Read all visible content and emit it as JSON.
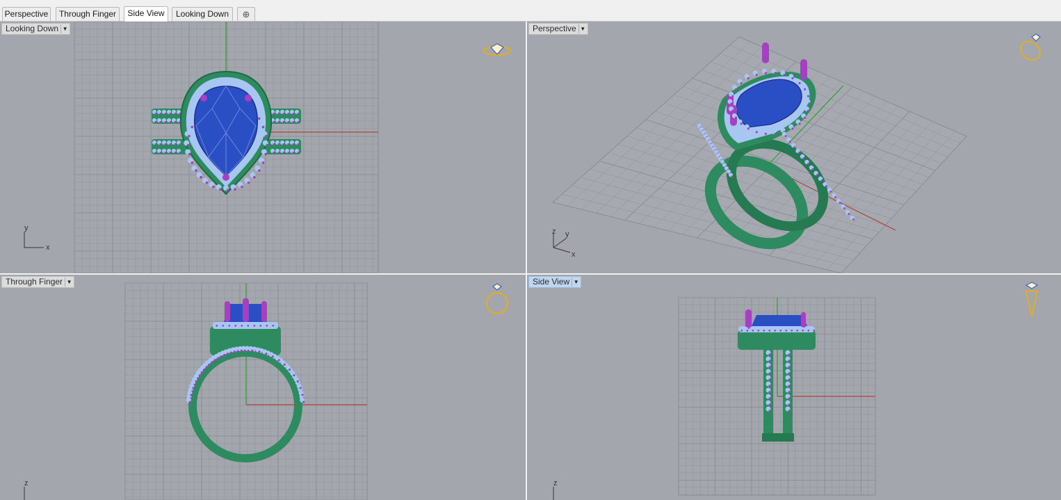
{
  "tabs": [
    {
      "label": "Perspective"
    },
    {
      "label": "Through Finger"
    },
    {
      "label": "Side View"
    },
    {
      "label": "Looking Down"
    }
  ],
  "active_tab": "Side View",
  "viewports": {
    "top_left": {
      "title": "Looking Down",
      "axis_a": "y",
      "axis_b": "x"
    },
    "top_right": {
      "title": "Perspective",
      "axis_a": "z",
      "axis_b": "y",
      "axis_c": "x"
    },
    "bottom_left": {
      "title": "Through Finger",
      "axis_a": "z"
    },
    "bottom_right": {
      "title": "Side View",
      "axis_a": "z"
    }
  },
  "icons": {
    "dropdown": "chevron-down-icon",
    "add_tab": "plus-icon",
    "view_widget": "ring-view-icon"
  },
  "colors": {
    "metal": "#2e8b60",
    "gem": "#2a4fc4",
    "prong": "#a63fc1",
    "accent_stone": "#a7c7f2",
    "grid": "#8d9197",
    "x_axis": "#b0423a",
    "y_axis": "#2f9c35",
    "widget": "#e3ae1d"
  }
}
